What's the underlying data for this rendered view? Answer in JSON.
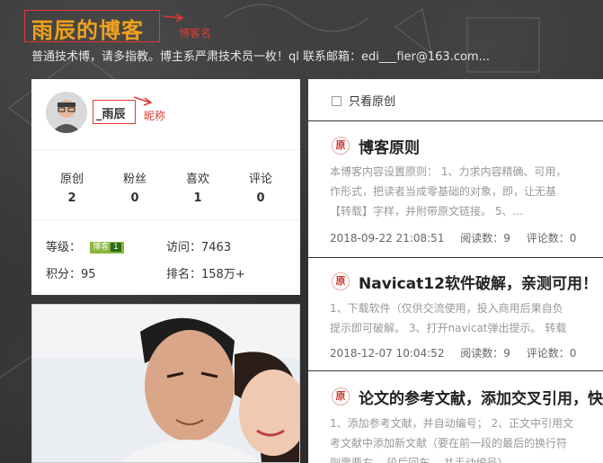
{
  "header": {
    "title": "雨辰的博客",
    "annotation": "博客名",
    "tagline": "普通技术博，请多指教。博主系严肃技术员一枚！ql 联系邮箱：edi___fier@163.com..."
  },
  "profile": {
    "nickname": "_雨辰",
    "nickname_annotation": "昵称",
    "stats": [
      {
        "label": "原创",
        "value": "2"
      },
      {
        "label": "粉丝",
        "value": "0"
      },
      {
        "label": "喜欢",
        "value": "1"
      },
      {
        "label": "评论",
        "value": "0"
      }
    ],
    "level_label": "等级：",
    "level_badge": "博客",
    "level_number": "1",
    "visits_label": "访问：",
    "visits": "7463",
    "points_label": "积分：",
    "points": "95",
    "rank_label": "排名：",
    "rank": "158万+"
  },
  "list": {
    "filter_label": "只看原创",
    "articles": [
      {
        "badge": "原",
        "title": "博客原则",
        "summary_1": "本博客内容设置原则： 1、力求内容精确、可用，",
        "summary_2": "作形式，把读者当成零基础的对象，即，让无基",
        "summary_3": "【转载】字样，并附带原文链接。 5、...",
        "date": "2018-09-22 21:08:51",
        "reads": "阅读数：9",
        "comments": "评论数：0"
      },
      {
        "badge": "原",
        "title": "Navicat12软件破解，亲测可用！",
        "summary_1": "1、下载软件（仅供交流使用，投入商用后果自负",
        "summary_2": "提示即可破解。 3、打开navicat弹出提示。 转载",
        "date": "2018-12-07 10:04:52",
        "reads": "阅读数：9",
        "comments": "评论数：0"
      },
      {
        "badge": "原",
        "title": "论文的参考文献，添加交叉引用，快",
        "summary_1": "1、添加参考文献，并自动编号； 2、正文中引用文",
        "summary_2": "考文献中添加新文献（要在前一段的最后的换行符",
        "summary_3": "则需要右... 段后回车... 并手动编号）"
      }
    ]
  },
  "colors": {
    "accent_red": "#e03a2f",
    "title_orange": "#f0a11a",
    "level_green": "#8ab63a"
  }
}
